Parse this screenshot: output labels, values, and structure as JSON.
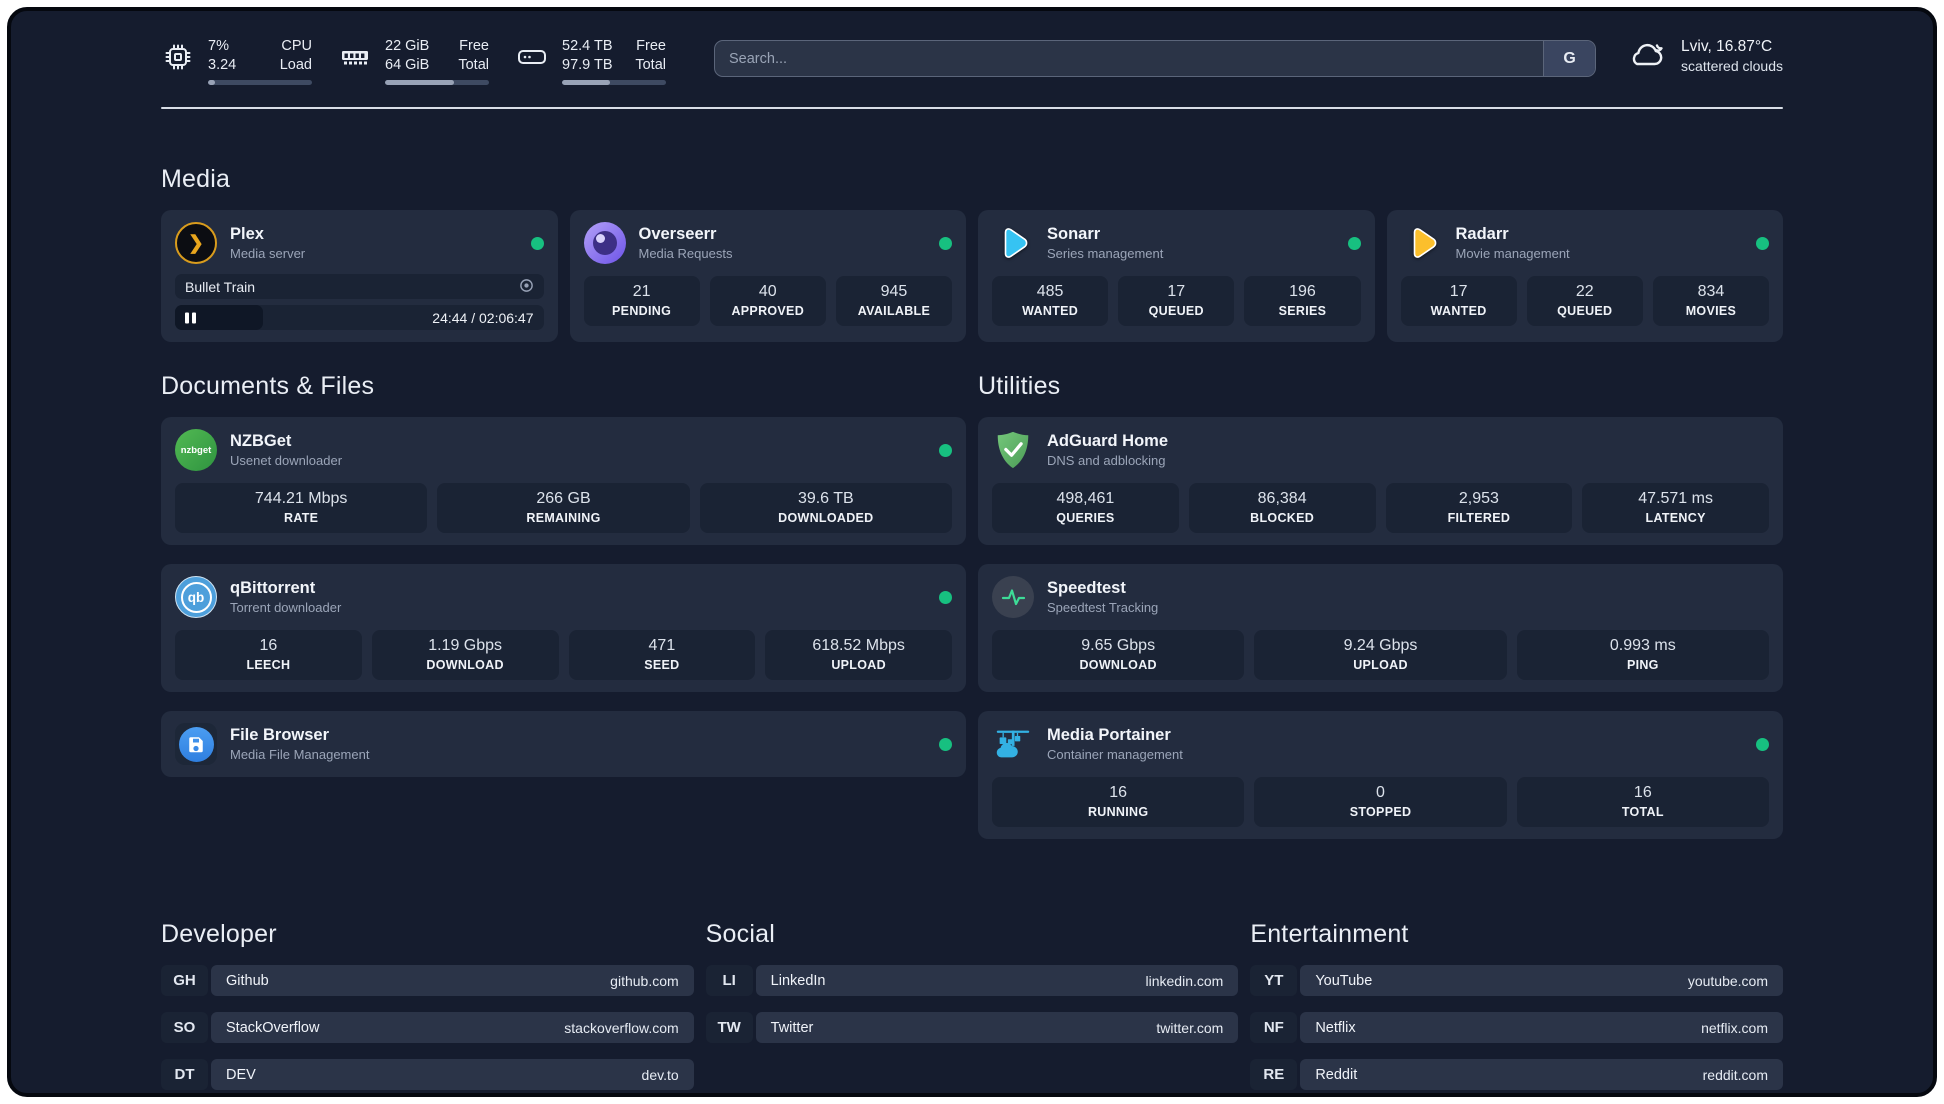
{
  "colors": {
    "background": "#151c2e",
    "card": "#232c3f",
    "tile": "#1a2334",
    "status_green": "#17c080",
    "plex_amber": "#e8a51d",
    "overseerr_purple": "#6d53e8",
    "sonarr_blue": "#36c3f2",
    "radarr_amber": "#fbbf2c",
    "nzbget_green": "#3ba748",
    "qbittorrent_blue": "#4d9fdb",
    "filebrowser_blue": "#3b8bec",
    "adguard_green": "#5fb767",
    "speedtest_green": "#3ddc97",
    "portainer_blue": "#33b1e3"
  },
  "topbar": {
    "stats": [
      {
        "icon": "cpu-icon",
        "values": [
          "7%",
          "3.24"
        ],
        "labels": [
          "CPU",
          "Load"
        ],
        "progress": 7
      },
      {
        "icon": "ram-icon",
        "values": [
          "22 GiB",
          "64 GiB"
        ],
        "labels": [
          "Free",
          "Total"
        ],
        "progress": 66
      },
      {
        "icon": "disk-icon",
        "values": [
          "52.4 TB",
          "97.9 TB"
        ],
        "labels": [
          "Free",
          "Total"
        ],
        "progress": 46
      }
    ],
    "search": {
      "placeholder": "Search...",
      "engine_button": "G"
    },
    "weather": {
      "summary": "Lviv, 16.87°C",
      "condition": "scattered clouds"
    }
  },
  "sections": {
    "media": {
      "title": "Media",
      "cards": [
        {
          "name": "Plex",
          "subtitle": "Media server",
          "online": true,
          "player": {
            "title": "Bullet Train",
            "time": "24:44 / 02:06:47",
            "progress": 24
          }
        },
        {
          "name": "Overseerr",
          "subtitle": "Media Requests",
          "online": true,
          "stats": [
            {
              "value": "21",
              "label": "PENDING"
            },
            {
              "value": "40",
              "label": "APPROVED"
            },
            {
              "value": "945",
              "label": "AVAILABLE"
            }
          ]
        },
        {
          "name": "Sonarr",
          "subtitle": "Series management",
          "online": true,
          "stats": [
            {
              "value": "485",
              "label": "WANTED"
            },
            {
              "value": "17",
              "label": "QUEUED"
            },
            {
              "value": "196",
              "label": "SERIES"
            }
          ]
        },
        {
          "name": "Radarr",
          "subtitle": "Movie management",
          "online": true,
          "stats": [
            {
              "value": "17",
              "label": "WANTED"
            },
            {
              "value": "22",
              "label": "QUEUED"
            },
            {
              "value": "834",
              "label": "MOVIES"
            }
          ]
        }
      ]
    },
    "documents": {
      "title": "Documents & Files",
      "cards": [
        {
          "name": "NZBGet",
          "subtitle": "Usenet downloader",
          "online": true,
          "stats": [
            {
              "value": "744.21 Mbps",
              "label": "RATE"
            },
            {
              "value": "266 GB",
              "label": "REMAINING"
            },
            {
              "value": "39.6 TB",
              "label": "DOWNLOADED"
            }
          ]
        },
        {
          "name": "qBittorrent",
          "subtitle": "Torrent downloader",
          "online": true,
          "stats": [
            {
              "value": "16",
              "label": "LEECH"
            },
            {
              "value": "1.19 Gbps",
              "label": "DOWNLOAD"
            },
            {
              "value": "471",
              "label": "SEED"
            },
            {
              "value": "618.52 Mbps",
              "label": "UPLOAD"
            }
          ]
        },
        {
          "name": "File Browser",
          "subtitle": "Media File Management",
          "online": true
        }
      ]
    },
    "utilities": {
      "title": "Utilities",
      "cards": [
        {
          "name": "AdGuard Home",
          "subtitle": "DNS and adblocking",
          "stats": [
            {
              "value": "498,461",
              "label": "QUERIES"
            },
            {
              "value": "86,384",
              "label": "BLOCKED"
            },
            {
              "value": "2,953",
              "label": "FILTERED"
            },
            {
              "value": "47.571 ms",
              "label": "LATENCY"
            }
          ]
        },
        {
          "name": "Speedtest",
          "subtitle": "Speedtest Tracking",
          "stats": [
            {
              "value": "9.65 Gbps",
              "label": "DOWNLOAD"
            },
            {
              "value": "9.24 Gbps",
              "label": "UPLOAD"
            },
            {
              "value": "0.993 ms",
              "label": "PING"
            }
          ]
        },
        {
          "name": "Media Portainer",
          "subtitle": "Container management",
          "online": true,
          "stats": [
            {
              "value": "16",
              "label": "RUNNING"
            },
            {
              "value": "0",
              "label": "STOPPED"
            },
            {
              "value": "16",
              "label": "TOTAL"
            }
          ]
        }
      ]
    }
  },
  "links": {
    "developer": {
      "title": "Developer",
      "items": [
        {
          "badge": "GH",
          "name": "Github",
          "url": "github.com"
        },
        {
          "badge": "SO",
          "name": "StackOverflow",
          "url": "stackoverflow.com"
        },
        {
          "badge": "DT",
          "name": "DEV",
          "url": "dev.to"
        }
      ]
    },
    "social": {
      "title": "Social",
      "items": [
        {
          "badge": "LI",
          "name": "LinkedIn",
          "url": "linkedin.com"
        },
        {
          "badge": "TW",
          "name": "Twitter",
          "url": "twitter.com"
        }
      ]
    },
    "entertainment": {
      "title": "Entertainment",
      "items": [
        {
          "badge": "YT",
          "name": "YouTube",
          "url": "youtube.com"
        },
        {
          "badge": "NF",
          "name": "Netflix",
          "url": "netflix.com"
        },
        {
          "badge": "RE",
          "name": "Reddit",
          "url": "reddit.com"
        }
      ]
    }
  }
}
